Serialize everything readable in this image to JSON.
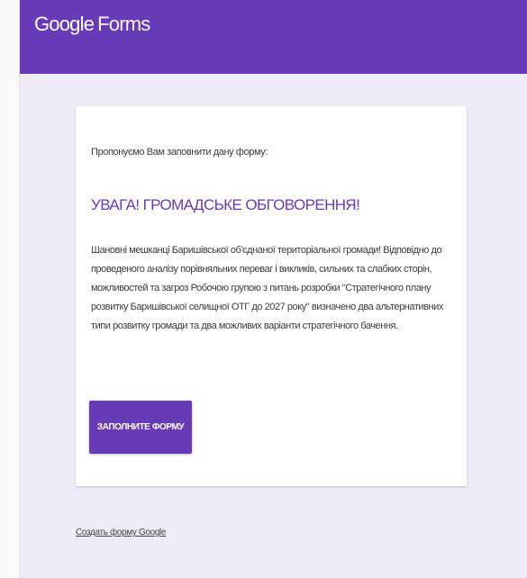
{
  "header": {
    "brand_google": "Google",
    "brand_forms": "Forms",
    "color": "#673ab7"
  },
  "card": {
    "intro": "Пропонуємо Вам заповнити дану форму:",
    "title": "УВАГА! ГРОМАДСЬКЕ ОБГОВОРЕННЯ!",
    "description": "Шановні мешканці Баришівської об'єднаної територіальної громади! Відповідно до проведеного аналізу порівняльних переваг і викликів, сильних та слабких сторін, можливостей та загроз Робочою групою з питань розробки \"Стратегічного плану розвитку Баришівської селищної ОТГ до 2027 року\" визначено два альтернативних типи розвитку громади та два можливих варіанти стратегічного бачення.",
    "button_label": "ЗАПОЛНИТЕ ФОРМУ"
  },
  "footer": {
    "link_text": "Создать форму Google"
  },
  "colors": {
    "accent": "#673ab7",
    "background": "#efebf7",
    "card": "#ffffff"
  }
}
